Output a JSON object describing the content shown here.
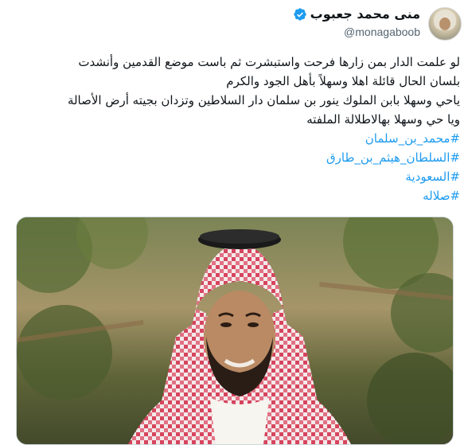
{
  "tweet": {
    "author": {
      "display_name": "منى محمد جعبوب",
      "handle": "@monagaboob",
      "verified_icon": "verified-badge-icon",
      "verified_color": "#1d9bf0"
    },
    "text_lines": [
      "لو علمت الدار بمن زارها فرحت واستبشرت ثم باست موضع القدمين وأنشدت",
      "بلسان الحال قائلة اهلا وسهلاً بأهل الجود والكرم",
      "ياحي وسهلا بابن الملوك ينور بن سلمان دار السلاطين وتزدان بجيته أرض الأصالة",
      "ويا حي  وسهلا بهالاطلالة الملفته"
    ],
    "hashtags": [
      "#محمد_بن_سلمان",
      "#السلطان_هيثم_بن_طارق",
      "#السعودية",
      "#صلاله"
    ],
    "hashtag_color": "#1d9bf0",
    "photo": {
      "subject": "man-in-red-white-shemagh-photo"
    }
  }
}
